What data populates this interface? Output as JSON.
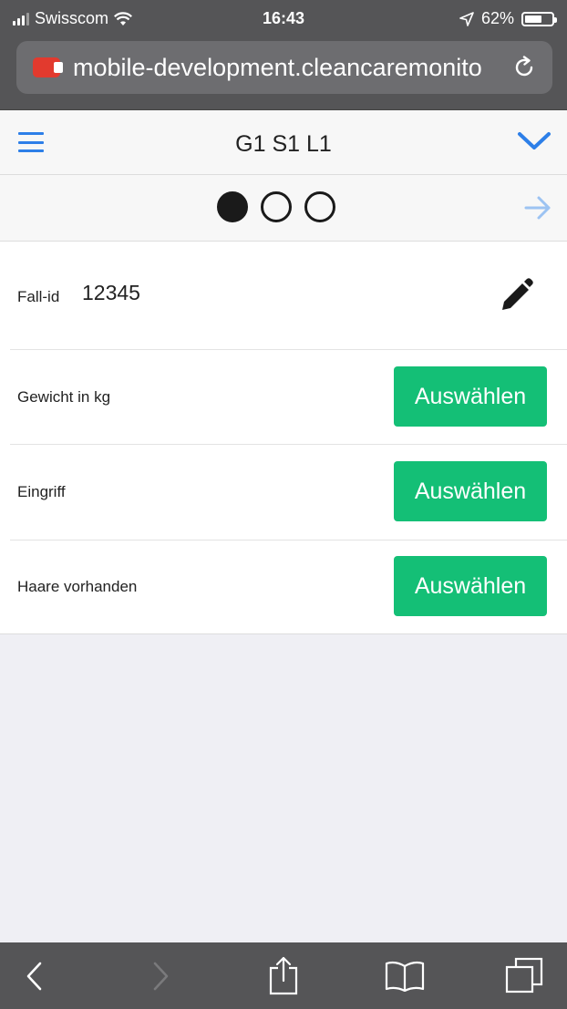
{
  "status_bar": {
    "carrier": "Swisscom",
    "time": "16:43",
    "battery": "62%"
  },
  "browser": {
    "url": "mobile-development.cleancaremonito",
    "icons": [
      "site-favicon",
      "reload-icon",
      "back-icon",
      "forward-icon",
      "share-icon",
      "bookmarks-icon",
      "tabs-icon"
    ]
  },
  "app_nav": {
    "title": "G1 S1 L1",
    "icons": [
      "hamburger-menu-icon",
      "chevron-down-icon"
    ],
    "accent_color": "#2d7fe8"
  },
  "steps": {
    "total": 3,
    "current": 1,
    "next_icon": "arrow-right-icon"
  },
  "form": {
    "fall_id": {
      "label": "Fall-id",
      "value": "12345",
      "edit_icon": "pencil-icon"
    },
    "rows": [
      {
        "label": "Gewicht in kg",
        "button": "Auswählen"
      },
      {
        "label": "Eingriff",
        "button": "Auswählen"
      },
      {
        "label": "Haare vorhanden",
        "button": "Auswählen"
      }
    ],
    "button_color": "#14bf76"
  }
}
